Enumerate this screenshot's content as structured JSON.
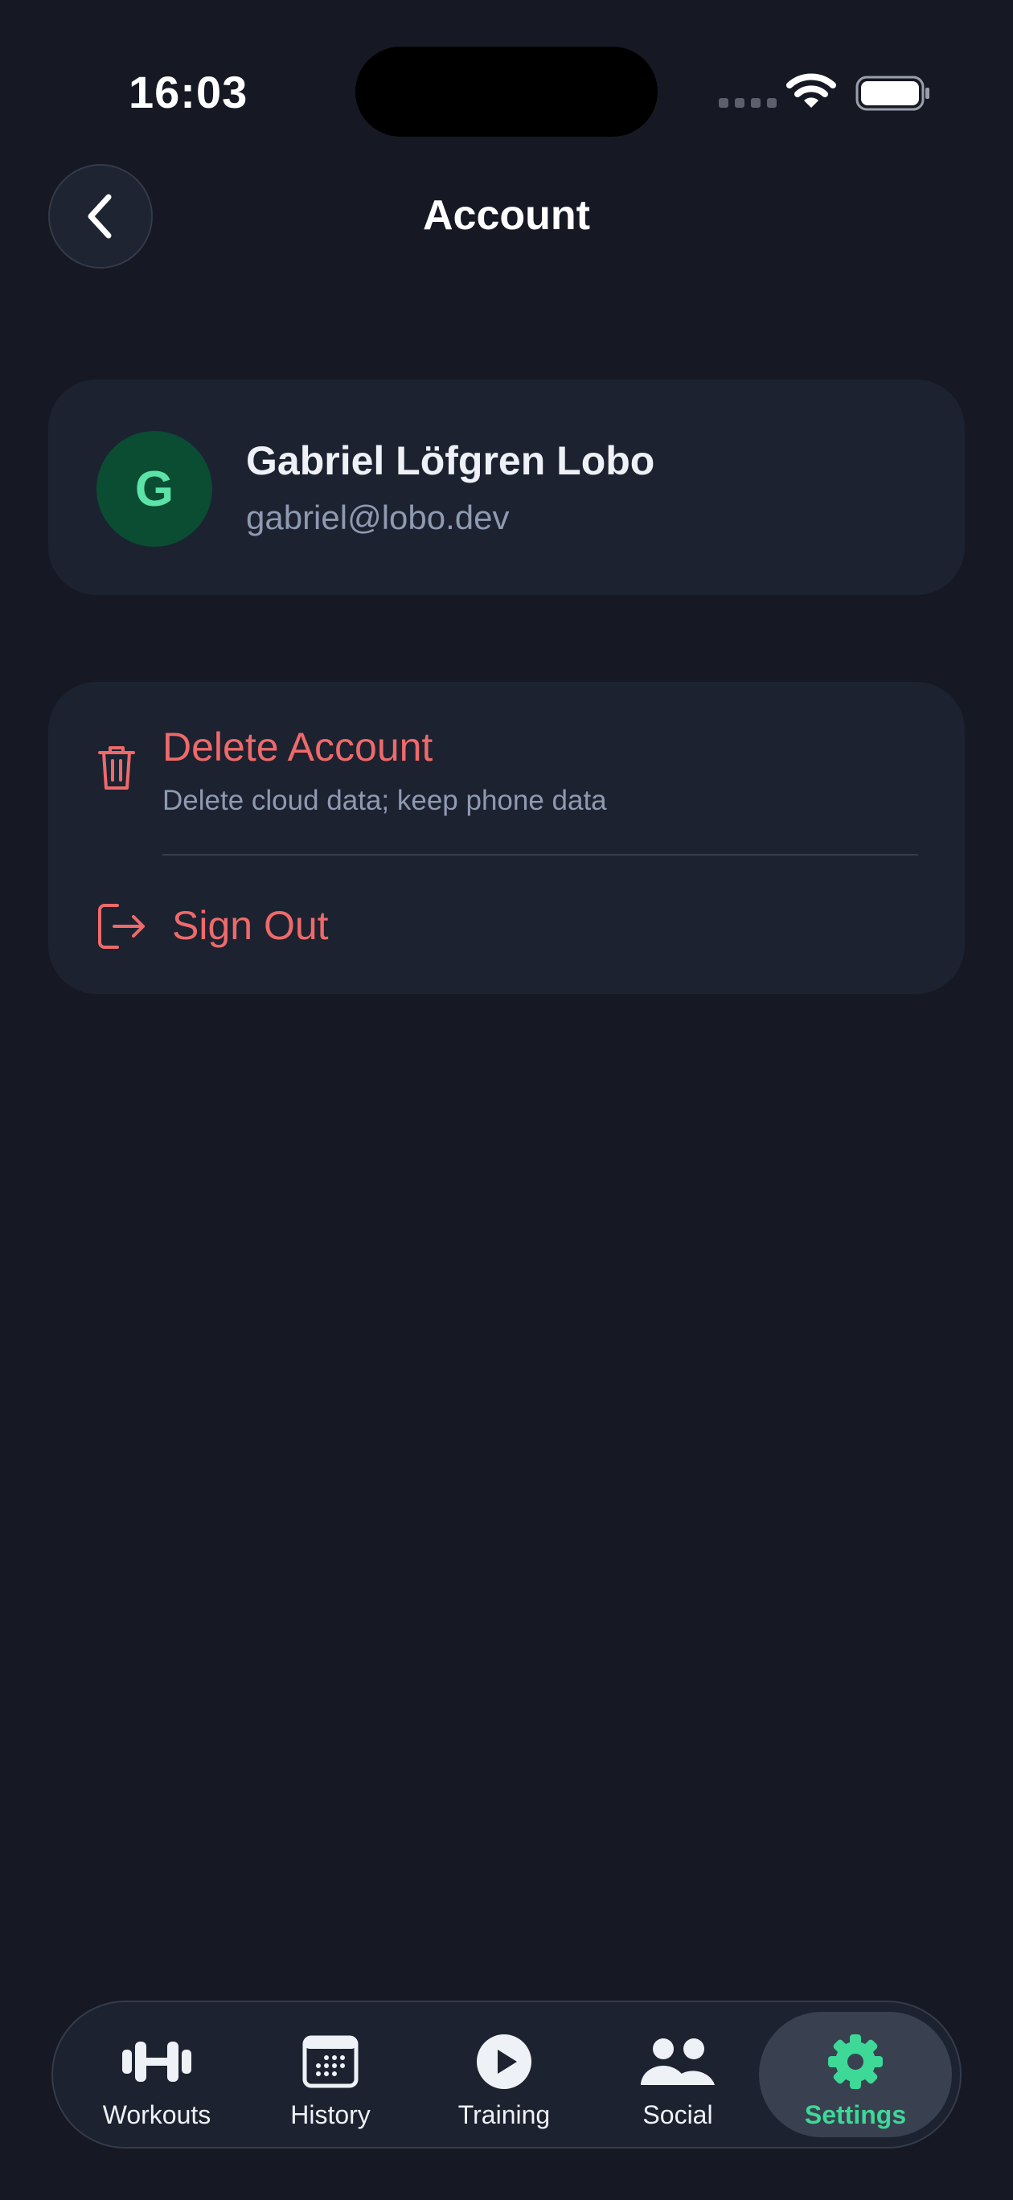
{
  "status_bar": {
    "time": "16:03"
  },
  "header": {
    "title": "Account"
  },
  "profile": {
    "initial": "G",
    "name": "Gabriel Löfgren Lobo",
    "email": "gabriel@lobo.dev"
  },
  "actions": {
    "delete_title": "Delete Account",
    "delete_subtitle": "Delete cloud data; keep phone data",
    "sign_out": "Sign Out"
  },
  "tabs": [
    {
      "label": "Workouts",
      "icon": "dumbbell-icon"
    },
    {
      "label": "History",
      "icon": "calendar-icon"
    },
    {
      "label": "Training",
      "icon": "play-icon"
    },
    {
      "label": "Social",
      "icon": "people-icon"
    },
    {
      "label": "Settings",
      "icon": "gear-icon",
      "active": true
    }
  ],
  "colors": {
    "background": "#161923",
    "card": "#1c2230",
    "danger": "#ee6a6a",
    "accent": "#3ed897",
    "avatar_bg": "#0a4d33"
  }
}
